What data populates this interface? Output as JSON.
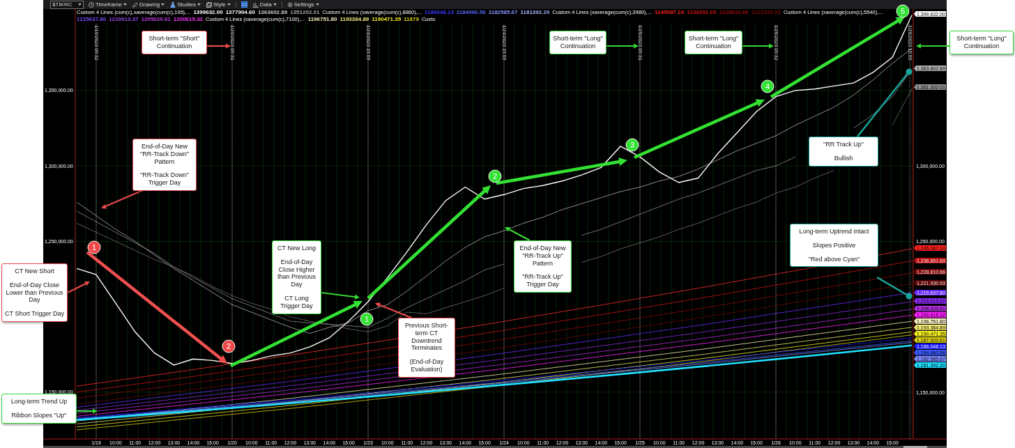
{
  "toolbar": {
    "symbol": "$TIKRC",
    "menus": [
      "Timeframe",
      "Drawing",
      "Studies",
      "Style",
      "Data",
      "Settings"
    ]
  },
  "legend": [
    {
      "name": "Custom 4 Lines (cum(c),xaverage(cum(c),195),...",
      "values": [
        {
          "text": "1399632.00",
          "color": "#ffffff"
        },
        {
          "text": "1377904.60",
          "color": "#ffffff"
        },
        {
          "text": "1363602.89",
          "color": "#cfcfcf"
        },
        {
          "text": "1351202.01",
          "color": "#a8a8a8"
        }
      ]
    },
    {
      "name": "Custom 4 Lines (xaverage(cum(c),8860),...",
      "values": [
        {
          "text": "1186048.13",
          "color": "#3a3aff"
        },
        {
          "text": "1184060.56",
          "color": "#5a6aff"
        },
        {
          "text": "1182585.67",
          "color": "#8a96ff"
        },
        {
          "text": "1181392.20",
          "color": "#a8b4ff"
        }
      ]
    },
    {
      "name": "Custom 4 Lines (xaverage(cum(c),3980),...",
      "values": [
        {
          "text": "1245087.24",
          "color": "#ff2020"
        },
        {
          "text": "1236651.69",
          "color": "#cc1111"
        },
        {
          "text": "1228810.66",
          "color": "#9a0c0c"
        },
        {
          "text": "1221930.93",
          "color": "#7a0808"
        }
      ]
    },
    {
      "name": "Custom 4 Lines (xaverage(cum(c),5540),...",
      "values": [
        {
          "text": "1215637.80",
          "color": "#7a4aff"
        },
        {
          "text": "1210013.37",
          "color": "#9a4aef"
        },
        {
          "text": "1205020.61",
          "color": "#c040e0"
        },
        {
          "text": "1200615.32",
          "color": "#ff30ff"
        }
      ]
    },
    {
      "name": "Custom 4 Lines (xaverage(cum(c),7100),...",
      "values": [
        {
          "text": "1196751.80",
          "color": "#f5f0c0"
        },
        {
          "text": "1193384.89",
          "color": "#f0e880"
        },
        {
          "text": "1190471.35",
          "color": "#f5f020"
        },
        {
          "text": "11879",
          "color": "#d8d010"
        }
      ]
    },
    {
      "name": "Custo"
    }
  ],
  "chart": {
    "chart_data": {
      "type": "line",
      "grid": true,
      "ylim": [
        1119000,
        1404000
      ],
      "categories": [
        null,
        "1/19",
        "10:00",
        "11:00",
        "12:00",
        "13:00",
        "14:00",
        "15:00",
        "1/20",
        "10:00",
        "11:00",
        "12:00",
        "13:00",
        "14:00",
        "15:00",
        "1/23",
        "10:00",
        "11:00",
        "12:00",
        "13:00",
        "14:00",
        "15:00",
        "1/24",
        "10:00",
        "11:00",
        "12:00",
        "13:00",
        "14:00",
        "15:00",
        "1/25",
        "10:00",
        "11:00",
        "12:00",
        "13:00",
        "14:00",
        "15:00",
        "1/26",
        "10:00",
        "11:00",
        "12:00",
        "13:00",
        "14:00",
        "15:00",
        null
      ],
      "yticks": [
        {
          "value": 1150000,
          "label": "1,150,000.00"
        },
        {
          "value": 1250000,
          "label": "1,250,000.00"
        },
        {
          "value": 1300000,
          "label": "1,300,000.00"
        },
        {
          "value": 1350000,
          "label": "1,350,000.00"
        }
      ],
      "series": [
        {
          "color": "#ffffff",
          "values": [
            1232000,
            1228000,
            1209000,
            1190000,
            1176000,
            1168000,
            1172000,
            1171000,
            1169000,
            1171000,
            1174000,
            1176000,
            1180000,
            1186000,
            1197000,
            1210000,
            1226000,
            1243000,
            1261000,
            1277000,
            1286000,
            1278000,
            1281000,
            1285000,
            1287000,
            1290000,
            1294000,
            1299000,
            1313000,
            1306000,
            1296000,
            1289000,
            1292000,
            1308000,
            1322000,
            1336000,
            1346000,
            1350000,
            1351000,
            1353000,
            1355000,
            1362000,
            1372000,
            1400000
          ]
        },
        {
          "color": "#c8c8c8",
          "values": [
            1276000,
            1267000,
            1258000,
            1250000,
            1241000,
            1232000,
            1224000,
            1216000,
            1208000,
            1203000,
            1198000,
            1193000,
            1189000,
            1193000,
            1196000,
            1204000,
            1208000,
            1217000,
            1227000,
            1237000,
            1246000,
            1253000,
            1257000,
            1262000,
            1266000,
            1271000,
            1275000,
            1279000,
            1283000,
            1286000,
            1290000,
            1293000,
            1298000,
            1304000,
            1310000,
            1315000,
            1320000,
            1327000,
            1333000,
            1339000,
            1347000,
            1357000,
            1368000,
            1378000
          ]
        },
        {
          "color": "#a0a0a0",
          "values": [
            1270000,
            1263000,
            1256000,
            1249000,
            1242000,
            1233000,
            1226000,
            1219000,
            1212000,
            1207000,
            1202000,
            1197000,
            1196000,
            1195000,
            1194000,
            1193000,
            1199000,
            1206000,
            1212000,
            1218000,
            1224000,
            1231000,
            1235000,
            null,
            null,
            null,
            1254000,
            1258000,
            1263000,
            1268000,
            1273000,
            1278000,
            1282000,
            1287000,
            1292000,
            1297000,
            1300000,
            1306000,
            null,
            null,
            1325000,
            1334000,
            1346000,
            1364000
          ]
        },
        {
          "color": "#808080",
          "values": [
            1262000,
            1256000,
            1250000,
            1244000,
            1238000,
            1233000,
            1227000,
            1220000,
            1214000,
            1209000,
            1205000,
            1200000,
            1197000,
            1195000,
            1192000,
            1190000,
            1194000,
            1203000,
            1202000,
            1206000,
            1210000,
            1214000,
            1219000,
            null,
            null,
            null,
            1236000,
            1240000,
            1245000,
            1249000,
            1253000,
            1258000,
            1262000,
            1267000,
            1272000,
            1276000,
            1282000,
            1286000,
            1292000,
            1297000,
            null,
            null,
            1327000,
            1351000
          ]
        }
      ]
    },
    "right_axis": [
      "1,300,000.00",
      "1,250,000.00",
      "1,150,000.00"
    ],
    "session_markers": [
      {
        "label": "1/19/2023 09:32"
      },
      {
        "label": "1/20/2023 09:31"
      },
      {
        "label": "1/23/2023 15:59"
      },
      {
        "label": "1/24/2023 15:59"
      },
      {
        "label": "1/25/2023 09:31"
      },
      {
        "label": "1/26/2023 09:32"
      },
      {
        "label": "1/26/2023 15:59"
      }
    ],
    "price_tags": [
      {
        "text": "1,399,632.00",
        "color": "#ffffff"
      },
      {
        "text": "1,363,602.89",
        "color": "#b0b0b0"
      },
      {
        "text": "1,351,202.01",
        "color": "#909090"
      },
      {
        "text": "1,245,087.24",
        "color": "#ff2020"
      },
      {
        "text": "1,236,651.69",
        "color": "#c01010"
      },
      {
        "text": "1,228,810.66",
        "color": "#800808"
      },
      {
        "text": "1,221,930.93",
        "color": "#600505"
      },
      {
        "text": "1,215,637.80",
        "color": "#6a2aff"
      },
      {
        "text": "1,210,013.37",
        "color": "#8a2aef"
      },
      {
        "text": "1,205,020.61",
        "color": "#b030e0"
      },
      {
        "text": "1,200,615.32",
        "color": "#ff20ff"
      },
      {
        "text": "1,196,751.80",
        "color": "#f5f0c0"
      },
      {
        "text": "1,193,384.89",
        "color": "#f0e870"
      },
      {
        "text": "1,190,471.35",
        "color": "#f5f020"
      },
      {
        "text": "1,187,920.61",
        "color": "#d8d010"
      },
      {
        "text": "1,186,048.13",
        "color": "#1a1aff"
      },
      {
        "text": "1,184,060.56",
        "color": "#3a5aff"
      },
      {
        "text": "1,182,585.67",
        "color": "#7a8aff"
      },
      {
        "text": "1,181,392.20",
        "color": "#20e0ff"
      }
    ]
  },
  "step_markers": [
    {
      "label": "1",
      "color": "#f04848"
    },
    {
      "label": "2",
      "color": "#f04848"
    },
    {
      "label": "1",
      "color": "#33e233"
    },
    {
      "label": "2",
      "color": "#33e233"
    },
    {
      "label": "3",
      "color": "#33e233"
    },
    {
      "label": "4",
      "color": "#33e233"
    },
    {
      "label": "5",
      "color": "#33e233"
    }
  ],
  "callouts": [
    {
      "kind": "arrow",
      "color": "#e84a4a",
      "paragraphs": [
        "Short-term \"Short\" Continuation"
      ]
    },
    {
      "kind": "arrow",
      "color": "#e84a4a",
      "paragraphs": [
        "End-of-Day New \"RR-Track Down\" Pattern",
        "\"RR-Track Down\" Trigger Day"
      ]
    },
    {
      "kind": "arrow",
      "color": "#e84a4a",
      "paragraphs": [
        "CT New Short",
        "End-of-Day Close Lower than Previous Day",
        "CT Short Trigger Day"
      ]
    },
    {
      "kind": "arrow",
      "color": "#33d633",
      "paragraphs": [
        "CT New Long",
        "End-of-Day Close Higher than Previous Day",
        "CT Long Trigger Day"
      ]
    },
    {
      "kind": "arrow",
      "color": "#e84a4a",
      "paragraphs": [
        "Previous Short-term CT Downtrend Terminates",
        "(End-of-Day Evaluation)"
      ]
    },
    {
      "kind": "arrow",
      "color": "#33d633",
      "paragraphs": [
        "End-of-Day New \"RR-Track Up\" Pattern",
        "\"RR-Track Up\" Trigger Day"
      ]
    },
    {
      "kind": "arrow",
      "color": "#33d633",
      "paragraphs": [
        "Short-term \"Long\" Continuation"
      ]
    },
    {
      "kind": "arrow",
      "color": "#33d633",
      "paragraphs": [
        "Short-term \"Long\" Continuation"
      ]
    },
    {
      "kind": "arrow",
      "color": "#33d633",
      "paragraphs": [
        "Short-term \"Long\" Continuation"
      ]
    },
    {
      "kind": "connector",
      "color": "#1aa39a",
      "paragraphs": [
        "\"RR Track Up\"",
        "Bullish"
      ]
    },
    {
      "kind": "connector",
      "color": "#1aa39a",
      "paragraphs": [
        "Long-term Uptrend Intact",
        "Slopes Positive",
        "\"Red above Cyan\""
      ]
    },
    {
      "kind": "arrow",
      "color": "#33d633",
      "paragraphs": [
        "Long-term Trend Up",
        "Ribbon Slopes \"Up\""
      ]
    }
  ]
}
